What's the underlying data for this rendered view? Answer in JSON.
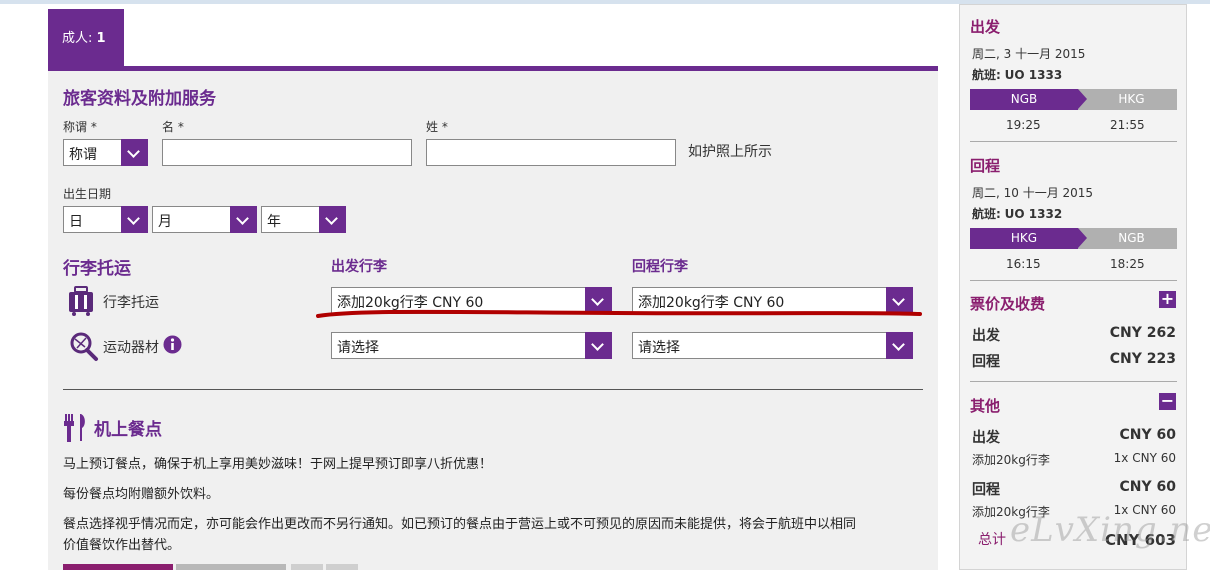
{
  "tab": {
    "label": "成人: ",
    "count": "1"
  },
  "passenger": {
    "section_title": "旅客资料及附加服务",
    "title_label": "称谓 *",
    "given_name_label": "名 *",
    "surname_label": "姓 *",
    "title_select": "称谓",
    "passport_hint": "如护照上所示",
    "dob_label": "出生日期",
    "dob_day": "日",
    "dob_month": "月",
    "dob_year": "年"
  },
  "baggage": {
    "section_title": "行李托运",
    "outbound_header": "出发行李",
    "return_header": "回程行李",
    "checked_label": "行李托运",
    "sports_label": "运动器材",
    "checked_outbound": "添加20kg行李 CNY 60",
    "checked_return": "添加20kg行李 CNY 60",
    "sports_outbound": "请选择",
    "sports_return": "请选择"
  },
  "meals": {
    "section_title": "机上餐点",
    "p1": "马上预订餐点，确保于机上享用美妙滋味！于网上提早预订即享八折优惠！",
    "p2": "每份餐点均附赠额外饮料。",
    "p3a": "餐点选择视乎情况而定，亦可能会作出更改而不另行通知。如已预订的餐点由于营运上或不可预见的原因而未能提供，将会于航班中以相同",
    "p3b": "价值餐饮作出替代。"
  },
  "sidebar": {
    "outbound": {
      "title": "出发",
      "date": "周二, 3 十一月 2015",
      "flight_label": "航班:",
      "flight_no": "UO 1333",
      "from": "NGB",
      "to": "HKG",
      "dep_time": "19:25",
      "arr_time": "21:55"
    },
    "return": {
      "title": "回程",
      "date": "周二, 10 十一月 2015",
      "flight_label": "航班:",
      "flight_no": "UO 1332",
      "from": "HKG",
      "to": "NGB",
      "dep_time": "16:15",
      "arr_time": "18:25"
    },
    "fares": {
      "title": "票价及收费",
      "toggle": "+",
      "outbound_label": "出发",
      "outbound_value": "CNY 262",
      "return_label": "回程",
      "return_value": "CNY 223"
    },
    "other": {
      "title": "其他",
      "toggle": "−",
      "outbound_label": "出发",
      "outbound_value": "CNY 60",
      "outbound_item": "添加20kg行李",
      "outbound_item_qty": "1x CNY 60",
      "return_label": "回程",
      "return_value": "CNY 60",
      "return_item": "添加20kg行李",
      "return_item_qty": "1x CNY 60"
    },
    "total_label": "总计",
    "total_value": "CNY 603"
  },
  "watermark": "eLvXing.net",
  "colors": {
    "brand_purple": "#6b2b8f",
    "sidebar_title": "#8a1e6e",
    "annotation_red": "#b00000"
  },
  "icons": [
    "chevron-down-icon",
    "luggage-icon",
    "sports-equipment-icon",
    "info-icon",
    "cutlery-icon",
    "plus-icon",
    "minus-icon"
  ]
}
